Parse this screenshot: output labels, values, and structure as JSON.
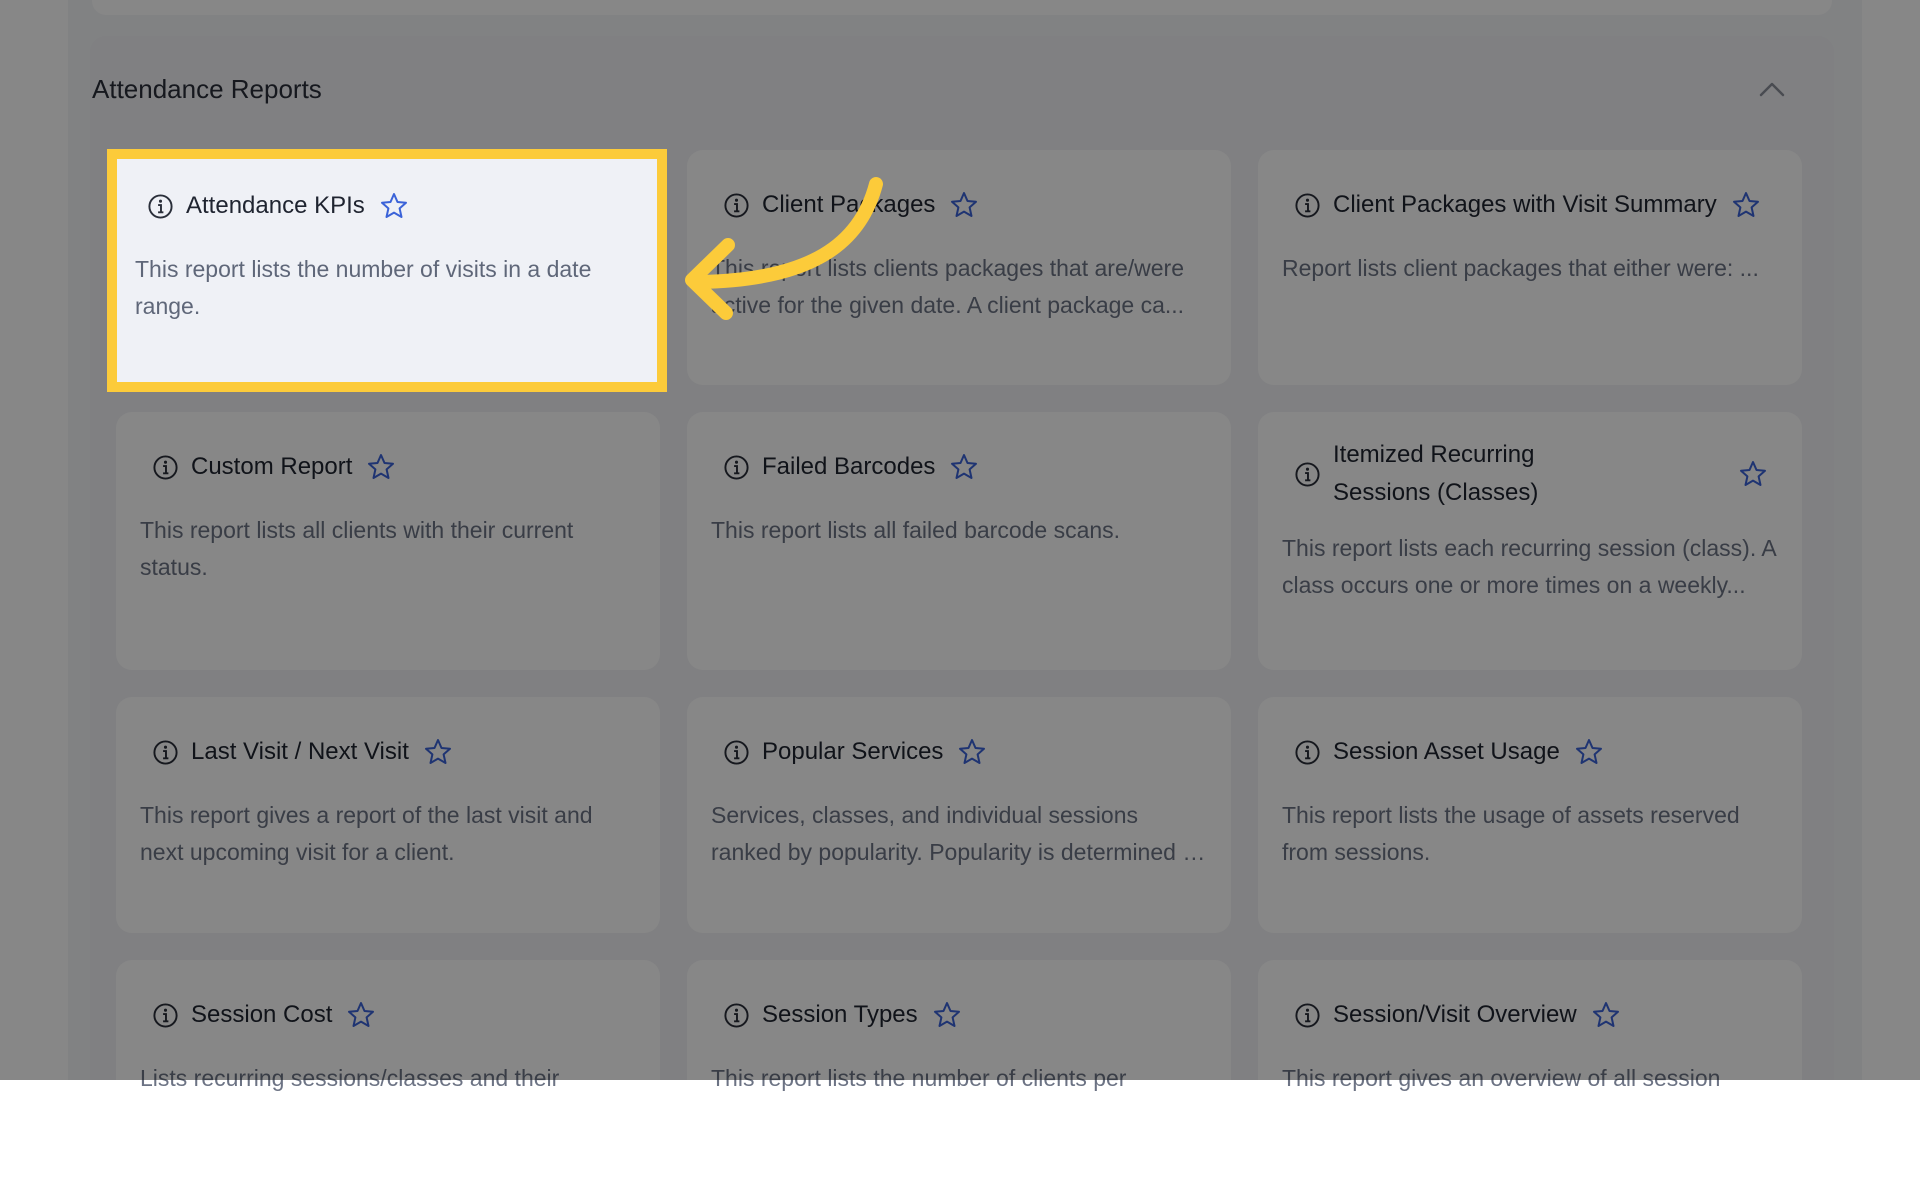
{
  "section": {
    "title": "Attendance Reports"
  },
  "colors": {
    "highlight": "#fccb3a",
    "star": "#3b63d8",
    "overlay": "rgba(0,0,0,0.47)"
  },
  "cards": [
    {
      "title": "Attendance KPIs",
      "desc": "This report lists the number of visits in a date range.",
      "highlighted": true
    },
    {
      "title": "Client Packages",
      "desc": "This report lists clients packages that are/were active for the given date. A client package ca..."
    },
    {
      "title": "Client Packages with Visit Summary",
      "desc": "Report lists client packages that either were: ..."
    },
    {
      "title": "Custom Report",
      "desc": "This report lists all clients with their current status."
    },
    {
      "title": "Failed Barcodes",
      "desc": "This report lists all failed barcode scans."
    },
    {
      "title": "Itemized Recurring Sessions (Classes)",
      "desc": "This report lists each recurring session (class). A class occurs one or more times on a weekly..."
    },
    {
      "title": "Last Visit / Next Visit",
      "desc": "This report gives a report of the last visit and next upcoming visit for a client."
    },
    {
      "title": "Popular Services",
      "desc": "Services, classes, and individual sessions ranked by popularity. Popularity is determined by th..."
    },
    {
      "title": "Session Asset Usage",
      "desc": "This report lists the usage of assets reserved from sessions."
    },
    {
      "title": "Session Cost",
      "desc": "Lists recurring sessions/classes and their"
    },
    {
      "title": "Session Types",
      "desc": "This report lists the number of clients per"
    },
    {
      "title": "Session/Visit Overview",
      "desc": "This report gives an overview of all session"
    }
  ],
  "icons": {
    "info": "info-icon",
    "favorite": "star-outline-icon",
    "collapse": "chevron-up-icon",
    "pointer": "curved-arrow-icon"
  }
}
